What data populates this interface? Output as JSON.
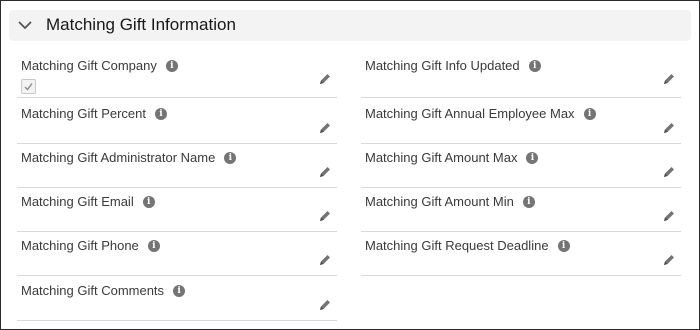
{
  "section": {
    "title": "Matching Gift Information"
  },
  "left_fields": [
    {
      "label": "Matching Gift Company",
      "type": "checkbox",
      "checked": true
    },
    {
      "label": "Matching Gift Percent"
    },
    {
      "label": "Matching Gift Administrator Name"
    },
    {
      "label": "Matching Gift Email"
    },
    {
      "label": "Matching Gift Phone"
    },
    {
      "label": "Matching Gift Comments"
    }
  ],
  "right_fields": [
    {
      "label": "Matching Gift Info Updated"
    },
    {
      "label": "Matching Gift Annual Employee Max"
    },
    {
      "label": "Matching Gift Amount Max"
    },
    {
      "label": "Matching Gift Amount Min"
    },
    {
      "label": "Matching Gift Request Deadline"
    }
  ],
  "icons": {
    "info": "info-icon",
    "edit": "pencil-icon",
    "collapse": "chevron-down-icon"
  },
  "colors": {
    "header_bg": "#f3f3f3",
    "icon": "#747474",
    "divider": "#d8d8d8"
  }
}
